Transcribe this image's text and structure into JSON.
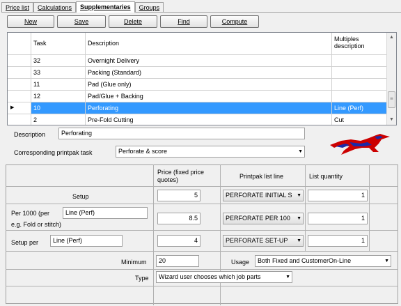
{
  "tabs": [
    "Price list",
    "Calculations",
    "Supplementaries",
    "Groups"
  ],
  "toolbar": {
    "new": "New",
    "save": "Save",
    "delete": "Delete",
    "find": "Find",
    "compute": "Compute"
  },
  "grid": {
    "headers": {
      "task": "Task",
      "description": "Description",
      "multiples": "Multiples description"
    },
    "rows": [
      {
        "task": "32",
        "description": "Overnight Delivery",
        "multiples": ""
      },
      {
        "task": "33",
        "description": "Packing (Standard)",
        "multiples": ""
      },
      {
        "task": "11",
        "description": "Pad (Glue only)",
        "multiples": ""
      },
      {
        "task": "12",
        "description": "Pad/Glue + Backing",
        "multiples": ""
      },
      {
        "task": "10",
        "description": "Perforating",
        "multiples": "Line (Perf)"
      },
      {
        "task": "2",
        "description": "Pre-Fold Cutting",
        "multiples": "Cut"
      }
    ]
  },
  "form": {
    "description_label": "Description",
    "description_value": "Perforating",
    "printpak_label": "Corresponding printpak task",
    "printpak_value": "Perforate & score"
  },
  "pricing": {
    "col_price": "Price (fixed price quotes)",
    "col_printpak": "Printpak list line",
    "col_list_qty": "List quantity",
    "setup_label": "Setup",
    "setup_price": "5",
    "setup_line": "PERFORATE INITIAL S",
    "setup_qty": "1",
    "per1000_label": "Per 1000 (per",
    "per1000_sub": "e.g. Fold or stitch)",
    "per1000_unit": "Line (Perf)",
    "per1000_price": "8.5",
    "per1000_line": "PERFORATE PER 100",
    "per1000_qty": "1",
    "setupper_label": "Setup per",
    "setupper_unit": "Line (Perf)",
    "setupper_price": "4",
    "setupper_line": "PERFORATE SET-UP",
    "setupper_qty": "1",
    "minimum_label": "Minimum",
    "minimum_value": "20",
    "usage_label": "Usage",
    "usage_value": "Both Fixed and CustomerOn-Line",
    "type_label": "Type",
    "type_value": "Wizard user chooses which job parts"
  },
  "colors": {
    "selection": "#3399ff",
    "logo": "#cc0000"
  }
}
